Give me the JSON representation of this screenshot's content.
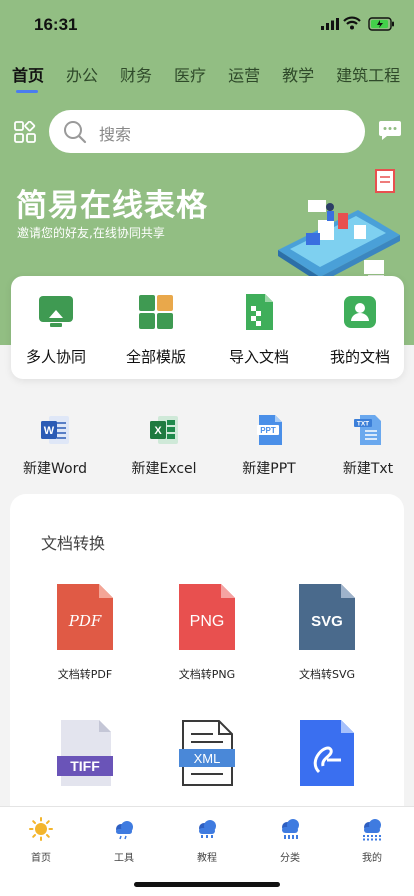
{
  "status": {
    "time": "16:31"
  },
  "tabs": [
    "首页",
    "办公",
    "财务",
    "医疗",
    "运营",
    "教学",
    "建筑工程"
  ],
  "search": {
    "placeholder": "搜索"
  },
  "banner": {
    "title": "简易在线表格",
    "subtitle": "邀请您的好友,在线协同共享"
  },
  "quick": [
    {
      "label": "多人协同",
      "icon": "collaboration-icon",
      "color": "#3f9a52"
    },
    {
      "label": "全部模版",
      "icon": "templates-icon",
      "color": "#3f9a52"
    },
    {
      "label": "导入文档",
      "icon": "import-doc-icon",
      "color": "#3fae5a"
    },
    {
      "label": "我的文档",
      "icon": "my-docs-icon",
      "color": "#3fae5a"
    }
  ],
  "new_docs": [
    {
      "label": "新建Word",
      "icon": "word-icon"
    },
    {
      "label": "新建Excel",
      "icon": "excel-icon"
    },
    {
      "label": "新建PPT",
      "icon": "ppt-icon"
    },
    {
      "label": "新建Txt",
      "icon": "txt-icon"
    }
  ],
  "conversion": {
    "title": "文档转换",
    "items": [
      {
        "label": "文档转PDF",
        "badge": "PDF",
        "icon": "pdf-file-icon",
        "color": "#e05a45"
      },
      {
        "label": "文档转PNG",
        "badge": "PNG",
        "icon": "png-file-icon",
        "color": "#e8504f"
      },
      {
        "label": "文档转SVG",
        "badge": "SVG",
        "icon": "svg-file-icon",
        "color": "#4a6a8c"
      },
      {
        "label": "",
        "badge": "TIFF",
        "icon": "tiff-file-icon",
        "color": "#6a54b8"
      },
      {
        "label": "",
        "badge": "XML",
        "icon": "xml-file-icon",
        "color": "#4a88d8"
      },
      {
        "label": "",
        "badge": "",
        "icon": "blue-doc-icon",
        "color": "#3a6ff0"
      }
    ]
  },
  "bottom_nav": [
    {
      "label": "首页",
      "icon": "sun-icon"
    },
    {
      "label": "工具",
      "icon": "tools-cloud-icon"
    },
    {
      "label": "教程",
      "icon": "tutorial-cloud-icon"
    },
    {
      "label": "分类",
      "icon": "category-cloud-icon"
    },
    {
      "label": "我的",
      "icon": "profile-cloud-icon"
    }
  ]
}
